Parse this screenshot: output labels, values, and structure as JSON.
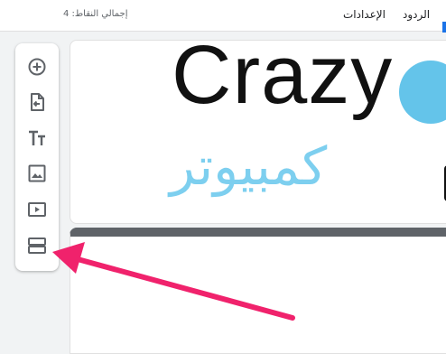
{
  "topbar": {
    "tabs": [
      "الردود",
      "الإعدادات"
    ],
    "points_label": "إجمالي النقاط: 4"
  },
  "toolbar": {
    "items": [
      "add-question-icon",
      "import-questions-icon",
      "add-title-icon",
      "add-image-icon",
      "add-video-icon",
      "add-section-icon"
    ]
  },
  "header_image": {
    "logo_text": "Crazy",
    "logo_arabic": "كمبيوتر"
  },
  "annotation": {
    "arrow_color": "#f0226c"
  }
}
